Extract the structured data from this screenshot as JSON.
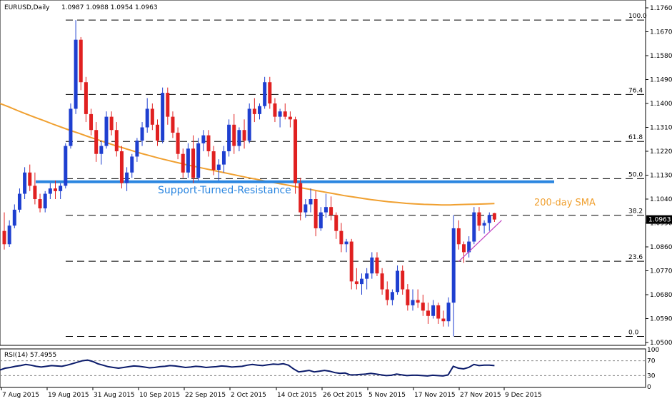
{
  "header": {
    "symbol": "EURUSD,Daily",
    "ohlc": "1.0987 1.0988 1.0954 1.0963"
  },
  "rsi_header": "RSI(14) 57.4955",
  "price_axis_labels": [
    "1.1760",
    "1.1670",
    "1.1580",
    "1.1490",
    "1.1400",
    "1.1310",
    "1.1220",
    "1.1130",
    "1.1040",
    "1.0950",
    "1.0860",
    "1.0770",
    "1.0680",
    "1.0590",
    "1.0500"
  ],
  "current_price_label": "1.0963",
  "rsi_axis_labels": [
    "100",
    "70",
    "30",
    "0"
  ],
  "x_axis_labels": [
    "7 Aug 2015",
    "19 Aug 2015",
    "31 Aug 2015",
    "10 Sep 2015",
    "22 Sep 2015",
    "2 Oct 2015",
    "14 Oct 2015",
    "26 Oct 2015",
    "5 Nov 2015",
    "17 Nov 2015",
    "27 Nov 2015",
    "9 Dec 2015"
  ],
  "annotations": {
    "support_label": "Support-Turned-Resistance",
    "sma_label": "200-day SMA"
  },
  "colors": {
    "bull": "#1e3fd0",
    "bear": "#e02020",
    "sma": "#f0a030",
    "support_line": "#2b86e0",
    "rsi": "#0a1a6a",
    "trendline": "#c040c0",
    "fib": "#000000"
  },
  "chart_data": [
    {
      "type": "candlestick",
      "title": "EURUSD,Daily",
      "ylim": [
        1.05,
        1.1785
      ],
      "fib_levels": [
        {
          "label": "100.0",
          "price": 1.1714
        },
        {
          "label": "76.4",
          "price": 1.1434
        },
        {
          "label": "61.8",
          "price": 1.1257
        },
        {
          "label": "50.0",
          "price": 1.1117
        },
        {
          "label": "38.2",
          "price": 1.0979
        },
        {
          "label": "23.6",
          "price": 1.0806
        },
        {
          "label": "0.0",
          "price": 1.0523
        }
      ],
      "support_resistance_price": 1.1105,
      "trendline": [
        [
          1.0805
        ],
        [
          1.096
        ]
      ],
      "candles": [
        [
          1.092,
          1.099,
          1.085,
          1.087
        ],
        [
          1.087,
          1.096,
          1.086,
          1.094
        ],
        [
          1.094,
          1.102,
          1.093,
          1.1
        ],
        [
          1.1,
          1.108,
          1.099,
          1.106
        ],
        [
          1.106,
          1.116,
          1.104,
          1.114
        ],
        [
          1.114,
          1.117,
          1.107,
          1.109
        ],
        [
          1.109,
          1.114,
          1.102,
          1.104
        ],
        [
          1.104,
          1.106,
          1.099,
          1.1005
        ],
        [
          1.1005,
          1.107,
          1.099,
          1.106
        ],
        [
          1.106,
          1.11,
          1.104,
          1.108
        ],
        [
          1.108,
          1.111,
          1.104,
          1.107
        ],
        [
          1.107,
          1.11,
          1.104,
          1.109
        ],
        [
          1.109,
          1.125,
          1.108,
          1.124
        ],
        [
          1.124,
          1.14,
          1.123,
          1.138
        ],
        [
          1.138,
          1.1714,
          1.136,
          1.164
        ],
        [
          1.164,
          1.165,
          1.145,
          1.148
        ],
        [
          1.148,
          1.15,
          1.133,
          1.136
        ],
        [
          1.136,
          1.138,
          1.128,
          1.13
        ],
        [
          1.13,
          1.133,
          1.118,
          1.121
        ],
        [
          1.121,
          1.126,
          1.117,
          1.124
        ],
        [
          1.124,
          1.137,
          1.123,
          1.135
        ],
        [
          1.135,
          1.137,
          1.128,
          1.13
        ],
        [
          1.13,
          1.133,
          1.12,
          1.122
        ],
        [
          1.122,
          1.124,
          1.108,
          1.11
        ],
        [
          1.11,
          1.116,
          1.107,
          1.114
        ],
        [
          1.114,
          1.121,
          1.112,
          1.12
        ],
        [
          1.12,
          1.127,
          1.118,
          1.126
        ],
        [
          1.126,
          1.133,
          1.124,
          1.131
        ],
        [
          1.131,
          1.142,
          1.129,
          1.138
        ],
        [
          1.138,
          1.14,
          1.13,
          1.132
        ],
        [
          1.132,
          1.134,
          1.124,
          1.126
        ],
        [
          1.126,
          1.146,
          1.125,
          1.144
        ],
        [
          1.144,
          1.146,
          1.132,
          1.135
        ],
        [
          1.135,
          1.137,
          1.127,
          1.129
        ],
        [
          1.129,
          1.131,
          1.119,
          1.121
        ],
        [
          1.121,
          1.123,
          1.112,
          1.114
        ],
        [
          1.114,
          1.125,
          1.112,
          1.123
        ],
        [
          1.123,
          1.128,
          1.11,
          1.112
        ],
        [
          1.112,
          1.127,
          1.111,
          1.125
        ],
        [
          1.125,
          1.13,
          1.122,
          1.128
        ],
        [
          1.128,
          1.13,
          1.12,
          1.122
        ],
        [
          1.122,
          1.124,
          1.113,
          1.115
        ],
        [
          1.115,
          1.119,
          1.111,
          1.117
        ],
        [
          1.117,
          1.124,
          1.114,
          1.122
        ],
        [
          1.122,
          1.134,
          1.12,
          1.132
        ],
        [
          1.132,
          1.136,
          1.121,
          1.124
        ],
        [
          1.124,
          1.131,
          1.122,
          1.13
        ],
        [
          1.13,
          1.134,
          1.123,
          1.126
        ],
        [
          1.126,
          1.14,
          1.125,
          1.138
        ],
        [
          1.138,
          1.142,
          1.133,
          1.136
        ],
        [
          1.136,
          1.14,
          1.134,
          1.139
        ],
        [
          1.139,
          1.15,
          1.138,
          1.148
        ],
        [
          1.148,
          1.15,
          1.138,
          1.14
        ],
        [
          1.14,
          1.142,
          1.133,
          1.135
        ],
        [
          1.135,
          1.138,
          1.131,
          1.137
        ],
        [
          1.137,
          1.14,
          1.134,
          1.135
        ],
        [
          1.135,
          1.137,
          1.131,
          1.134
        ],
        [
          1.134,
          1.135,
          1.106,
          1.11
        ],
        [
          1.11,
          1.112,
          1.096,
          1.099
        ],
        [
          1.099,
          1.104,
          1.097,
          1.102
        ],
        [
          1.102,
          1.108,
          1.099,
          1.104
        ],
        [
          1.104,
          1.107,
          1.09,
          1.093
        ],
        [
          1.093,
          1.101,
          1.092,
          1.099
        ],
        [
          1.099,
          1.106,
          1.097,
          1.101
        ],
        [
          1.101,
          1.105,
          1.096,
          1.098
        ],
        [
          1.098,
          1.099,
          1.089,
          1.092
        ],
        [
          1.092,
          1.095,
          1.084,
          1.087
        ],
        [
          1.087,
          1.089,
          1.084,
          1.088
        ],
        [
          1.088,
          1.089,
          1.07,
          1.073
        ],
        [
          1.073,
          1.078,
          1.07,
          1.072
        ],
        [
          1.072,
          1.076,
          1.068,
          1.074
        ],
        [
          1.074,
          1.078,
          1.07,
          1.076
        ],
        [
          1.076,
          1.084,
          1.074,
          1.082
        ],
        [
          1.082,
          1.084,
          1.075,
          1.076
        ],
        [
          1.076,
          1.078,
          1.068,
          1.07
        ],
        [
          1.07,
          1.073,
          1.064,
          1.066
        ],
        [
          1.066,
          1.07,
          1.064,
          1.069
        ],
        [
          1.069,
          1.079,
          1.068,
          1.077
        ],
        [
          1.077,
          1.079,
          1.068,
          1.07
        ],
        [
          1.07,
          1.072,
          1.062,
          1.064
        ],
        [
          1.064,
          1.07,
          1.062,
          1.066
        ],
        [
          1.066,
          1.07,
          1.063,
          1.065
        ],
        [
          1.065,
          1.068,
          1.06,
          1.062
        ],
        [
          1.062,
          1.065,
          1.057,
          1.06
        ],
        [
          1.06,
          1.066,
          1.059,
          1.064
        ],
        [
          1.064,
          1.065,
          1.057,
          1.059
        ],
        [
          1.059,
          1.062,
          1.056,
          1.058
        ],
        [
          1.058,
          1.067,
          1.056,
          1.065
        ],
        [
          1.065,
          1.098,
          1.0523,
          1.093
        ],
        [
          1.093,
          1.096,
          1.085,
          1.087
        ],
        [
          1.087,
          1.088,
          1.08,
          1.084
        ],
        [
          1.084,
          1.09,
          1.082,
          1.088
        ],
        [
          1.088,
          1.101,
          1.087,
          1.099
        ],
        [
          1.099,
          1.101,
          1.092,
          1.094
        ],
        [
          1.094,
          1.096,
          1.091,
          1.095
        ],
        [
          1.095,
          1.099,
          1.092,
          1.098
        ],
        [
          1.0987,
          1.0988,
          1.0954,
          1.0963
        ]
      ],
      "sma_200": [
        1.14,
        1.1387,
        1.1373,
        1.136,
        1.1347,
        1.1335,
        1.1322,
        1.131,
        1.1298,
        1.1287,
        1.1275,
        1.1264,
        1.1253,
        1.1242,
        1.1232,
        1.1222,
        1.1212,
        1.1203,
        1.1194,
        1.1186,
        1.1178,
        1.117,
        1.1163,
        1.1156,
        1.1149,
        1.1142,
        1.1135,
        1.1128,
        1.1121,
        1.1115,
        1.1108,
        1.1102,
        1.1096,
        1.109,
        1.1083,
        1.1077,
        1.1071,
        1.1065,
        1.1059,
        1.1053,
        1.1048,
        1.1043,
        1.1038,
        1.1034,
        1.103,
        1.1027,
        1.1024,
        1.1022,
        1.102,
        1.1019,
        1.1018,
        1.1018,
        1.1019,
        1.102,
        1.1021,
        1.1022,
        1.1023
      ]
    },
    {
      "type": "line",
      "title": "RSI(14) 57.4955",
      "ylim": [
        0,
        100
      ],
      "levels": [
        70,
        30
      ],
      "values": [
        45,
        50,
        52,
        55,
        57,
        60,
        58,
        55,
        53,
        55,
        57,
        56,
        55,
        58,
        62,
        66,
        70,
        72,
        68,
        62,
        58,
        54,
        52,
        50,
        52,
        54,
        56,
        55,
        53,
        51,
        52,
        54,
        55,
        57,
        56,
        54,
        52,
        53,
        55,
        54,
        52,
        53,
        54,
        56,
        55,
        53,
        54,
        55,
        58,
        60,
        58,
        57,
        59,
        61,
        60,
        62,
        58,
        48,
        40,
        42,
        44,
        40,
        42,
        44,
        42,
        38,
        36,
        37,
        32,
        32,
        33,
        34,
        36,
        34,
        32,
        30,
        31,
        34,
        32,
        30,
        31,
        31,
        30,
        29,
        31,
        30,
        29,
        32,
        55,
        50,
        48,
        52,
        60,
        57,
        58,
        58,
        57
      ]
    }
  ]
}
